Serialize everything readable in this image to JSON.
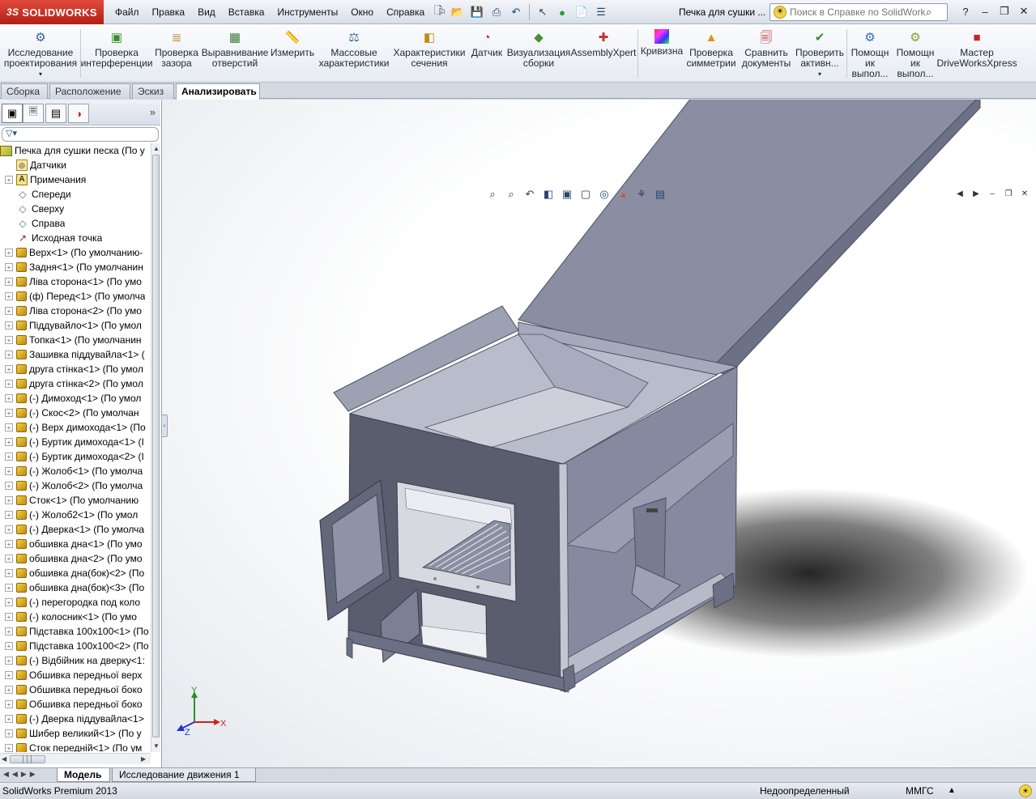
{
  "app": {
    "logo_prefix": "3S",
    "logo_text": "SOLIDWORKS",
    "doc_title": "Печка для сушки ..."
  },
  "menu": [
    "Файл",
    "Правка",
    "Вид",
    "Вставка",
    "Инструменты",
    "Окно",
    "Справка"
  ],
  "help_search": {
    "placeholder": "Поиск в Справке по SolidWorks"
  },
  "ribbon": {
    "items": [
      "Исследование проектирования",
      "Проверка интерференции",
      "Проверка зазора",
      "Выравнивание отверстий",
      "Измерить",
      "Массовые характеристики",
      "Характеристики сечения",
      "Датчик",
      "Визуализация сборки",
      "AssemblyXpert",
      "Кривизна",
      "Проверка симметрии",
      "Сравнить документы",
      "Проверить активн...",
      "Помощн ик выпол...",
      "Помощн ик выпол...",
      "Мастер DriveWorksXpress"
    ]
  },
  "cm_tabs": [
    "Сборка",
    "Расположение",
    "Эскиз",
    "Анализировать"
  ],
  "tree": {
    "root": "Печка для сушки песка  (По у",
    "items": [
      {
        "label": "Датчики",
        "icon": "sensor-icon",
        "exp": false
      },
      {
        "label": "Примечания",
        "icon": "annotation-icon",
        "exp": true
      },
      {
        "label": "Спереди",
        "icon": "plane-icon",
        "exp": false
      },
      {
        "label": "Сверху",
        "icon": "plane-icon",
        "exp": false
      },
      {
        "label": "Справа",
        "icon": "plane-icon",
        "exp": false
      },
      {
        "label": "Исходная точка",
        "icon": "origin-icon",
        "exp": false
      },
      {
        "label": "Верх<1> (По умолчанию-",
        "icon": "part-icon",
        "exp": true
      },
      {
        "label": "Задня<1> (По умолчанин",
        "icon": "part-icon",
        "exp": true
      },
      {
        "label": "Ліва сторона<1> (По умо",
        "icon": "part-icon",
        "exp": true
      },
      {
        "label": "(ф) Перед<1> (По умолча",
        "icon": "part-icon",
        "exp": true
      },
      {
        "label": "Ліва сторона<2> (По умо",
        "icon": "part-icon",
        "exp": true
      },
      {
        "label": "Піддувайло<1> (По умол",
        "icon": "part-icon",
        "exp": true
      },
      {
        "label": "Топка<1> (По умолчанин",
        "icon": "part-icon",
        "exp": true
      },
      {
        "label": "Зашивка піддувайла<1> (",
        "icon": "part-icon",
        "exp": true
      },
      {
        "label": "друга стінка<1> (По умол",
        "icon": "part-icon",
        "exp": true
      },
      {
        "label": "друга стінка<2> (По умол",
        "icon": "part-icon",
        "exp": true
      },
      {
        "label": "(-) Димоход<1> (По умол",
        "icon": "part-icon",
        "exp": true
      },
      {
        "label": "(-) Скос<2> (По умолчан",
        "icon": "part-icon",
        "exp": true
      },
      {
        "label": "(-) Верх димохода<1> (По",
        "icon": "part-icon",
        "exp": true
      },
      {
        "label": "(-) Буртик димохода<1> (І",
        "icon": "part-icon",
        "exp": true
      },
      {
        "label": "(-) Буртик димохода<2> (І",
        "icon": "part-icon",
        "exp": true
      },
      {
        "label": "(-) Жолоб<1> (По умолча",
        "icon": "part-icon",
        "exp": true
      },
      {
        "label": "(-) Жолоб<2> (По умолча",
        "icon": "part-icon",
        "exp": true
      },
      {
        "label": "Сток<1> (По умолчанию",
        "icon": "part-icon",
        "exp": true
      },
      {
        "label": "(-) Жолоб2<1> (По умол",
        "icon": "part-icon",
        "exp": true
      },
      {
        "label": "(-) Дверка<1> (По умолча",
        "icon": "part-icon",
        "exp": true
      },
      {
        "label": "обшивка дна<1> (По умо",
        "icon": "part-icon",
        "exp": true
      },
      {
        "label": "обшивка дна<2> (По умо",
        "icon": "part-icon",
        "exp": true
      },
      {
        "label": "обшивка дна(бок)<2> (По",
        "icon": "part-icon",
        "exp": true
      },
      {
        "label": "обшивка дна(бок)<3> (По",
        "icon": "part-icon",
        "exp": true
      },
      {
        "label": "(-) перегородка под коло",
        "icon": "part-icon",
        "exp": true
      },
      {
        "label": "(-) колосник<1> (По умо",
        "icon": "part-icon",
        "exp": true
      },
      {
        "label": "Підставка 100x100<1> (По",
        "icon": "part-icon",
        "exp": true
      },
      {
        "label": "Підставка 100x100<2> (По",
        "icon": "part-icon",
        "exp": true
      },
      {
        "label": "(-) Відбійник на дверку<1:",
        "icon": "part-icon",
        "exp": true
      },
      {
        "label": "Обшивка передньої верх",
        "icon": "part-icon",
        "exp": true
      },
      {
        "label": "Обшивка передньої боко",
        "icon": "part-icon",
        "exp": true
      },
      {
        "label": "Обшивка передньої боко",
        "icon": "part-icon",
        "exp": true
      },
      {
        "label": "(-) Дверка піддувайла<1>",
        "icon": "part-icon",
        "exp": true
      },
      {
        "label": "Шибер великий<1> (По у",
        "icon": "part-icon",
        "exp": true
      },
      {
        "label": "Сток передній<1> (По ум",
        "icon": "part-icon",
        "exp": true
      }
    ]
  },
  "triad": {
    "x": "X",
    "y": "Y",
    "z": "Z"
  },
  "bottom_tabs": [
    "Модель",
    "Исследование движения 1"
  ],
  "status": {
    "product": "SolidWorks Premium 2013",
    "definition": "Недоопределенный",
    "units": "ММГС"
  },
  "colors": {
    "logo_red": "#c92b1f",
    "model_gray": "#8e93a6",
    "model_dark": "#5b5f70"
  }
}
